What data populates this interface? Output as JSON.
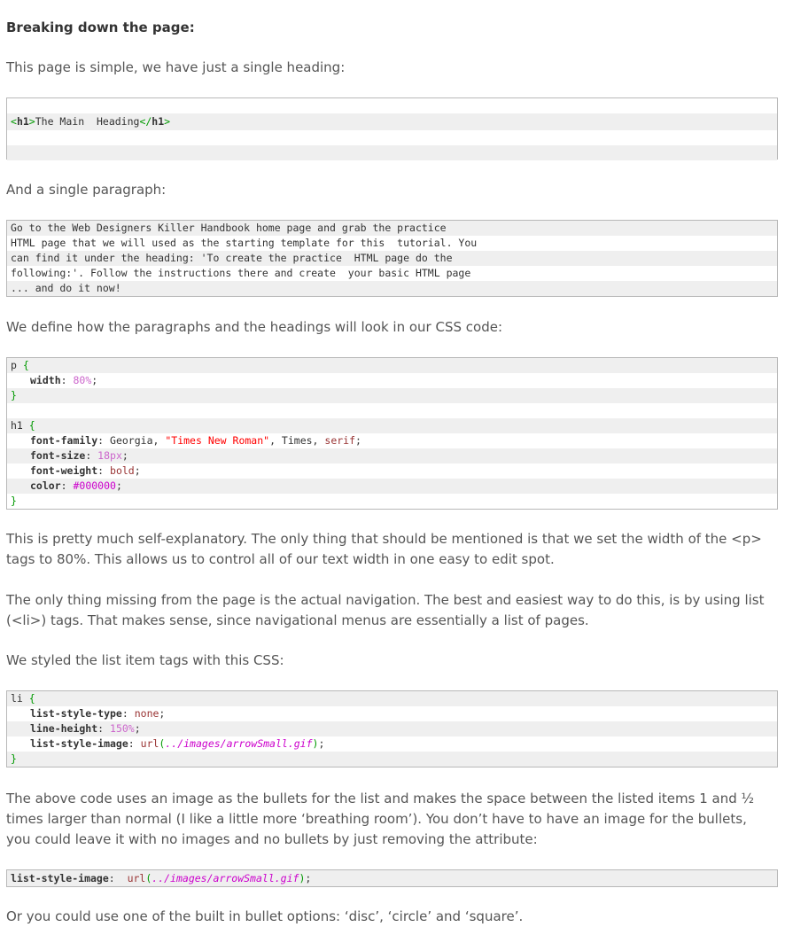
{
  "section_heading": "Breaking down the page:",
  "p1": "This page is simple, we have just a single heading:",
  "code1": {
    "open_tag": "h1",
    "text": "The Main  Heading",
    "close_tag": "h1"
  },
  "p2": "And a single paragraph:",
  "code2": {
    "lines": [
      "Go to the Web Designers Killer Handbook home page and grab the practice",
      "HTML page that we will used as the starting template for this  tutorial. You",
      "can find it under the heading: 'To create the practice  HTML page do the",
      "following:'. Follow the instructions there and create  your basic HTML page",
      "... and do it now!"
    ]
  },
  "p3": "We define how the paragraphs and the headings will look in our CSS code:",
  "code3": {
    "sel_p": "p",
    "open_brace": "{",
    "close_brace": "}",
    "width_prop": "width",
    "width_val": "80%",
    "sel_h1": "h1",
    "ff_prop": "font-family",
    "ff_val1": "Georgia",
    "ff_val2": "\"Times New Roman\"",
    "ff_val3": "Times",
    "ff_val4": "serif",
    "fs_prop": "font-size",
    "fs_val": "18px",
    "fw_prop": "font-weight",
    "fw_val": "bold",
    "color_prop": "color",
    "color_val": "#000000"
  },
  "p4": "This is pretty much self-explanatory. The only thing that should be mentioned is that we set the width of the <p> tags to 80%. This allows us to control all of our text width in one easy to edit spot.",
  "p5": "The only thing missing from the page is the actual navigation. The best and easiest way to do this, is by using list (<li>) tags. That makes sense, since navigational menus are essentially a list of pages.",
  "p6": "We styled the list item tags with this CSS:",
  "code4": {
    "sel": "li",
    "open_brace": "{",
    "close_brace": "}",
    "lst_prop": "list-style-type",
    "lst_val": "none",
    "lh_prop": "line-height",
    "lh_val": "150%",
    "lsi_prop": "list-style-image",
    "url_fn": "url",
    "url_path": "../images/arrowSmall.gif"
  },
  "p7": "The above code uses an image as the bullets for the list and makes the space between the listed items 1 and ½ times larger than normal (I like a little more ‘breathing room’). You don’t have to have an image for the bullets, you could leave it with no images and no bullets by just removing the attribute:",
  "code5": {
    "prop": "list-style-image",
    "url_fn": "url",
    "url_path": "../images/arrowSmall.gif"
  },
  "p8": "Or you could use one of the built in bullet options: ‘disc’, ‘circle’ and ‘square’."
}
